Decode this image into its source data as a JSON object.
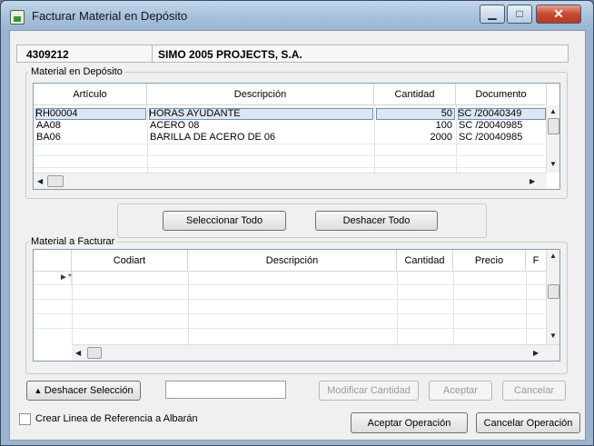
{
  "window": {
    "title": "Facturar Material en Depósito",
    "controls": {
      "minimize": "▁",
      "maximize": "□",
      "close": "✕"
    }
  },
  "header": {
    "code": "4309212",
    "name": "SIMO 2005 PROJECTS, S.A."
  },
  "deposit": {
    "label": "Material en Depósito",
    "columns": [
      "Artículo",
      "Descripción",
      "Cantidad",
      "Documento"
    ],
    "rows": [
      {
        "articulo": "RH00004",
        "descripcion": "HORAS AYUDANTE",
        "cantidad": "50",
        "documento": "SC /20040349"
      },
      {
        "articulo": "AA08",
        "descripcion": "ACERO 08",
        "cantidad": "100",
        "documento": "SC /20040985"
      },
      {
        "articulo": "BA06",
        "descripcion": "BARILLA DE ACERO DE 06",
        "cantidad": "2000",
        "documento": "SC /20040985"
      }
    ]
  },
  "actions": {
    "select_all": "Seleccionar Todo",
    "undo_all": "Deshacer Todo"
  },
  "invoice": {
    "label": "Material a Facturar",
    "columns": [
      "Codiart",
      "Descripción",
      "Cantidad",
      "Precio",
      "F"
    ]
  },
  "bottom": {
    "undo_selection": "Deshacer Selección",
    "modify_quantity": "Modificar Cantidad",
    "accept": "Aceptar",
    "cancel": "Cancelar",
    "create_reference_label": "Crear Linea de Referencia a Albarán",
    "accept_operation": "Aceptar Operación",
    "cancel_operation": "Cancelar Operación"
  }
}
